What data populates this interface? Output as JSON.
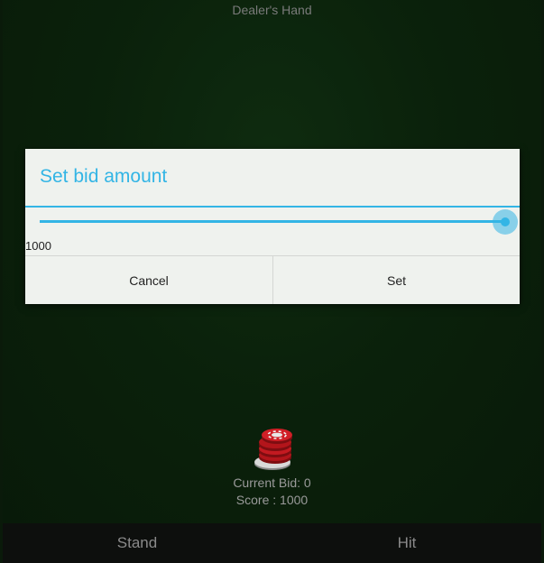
{
  "table": {
    "dealer_label": "Dealer's Hand",
    "chip_icon": "poker-chip-stack-icon",
    "current_bid_text": "Current Bid: 0",
    "score_text": "Score : 1000"
  },
  "dialog": {
    "title": "Set bid amount",
    "slider": {
      "value": "1000",
      "fraction": 1.0
    },
    "cancel_label": "Cancel",
    "set_label": "Set"
  },
  "bottom_bar": {
    "stand_label": "Stand",
    "hit_label": "Hit"
  },
  "colors": {
    "accent": "#33b5e5",
    "dialog_bg": "#eff2ee",
    "chip_red": "#b3151b"
  }
}
